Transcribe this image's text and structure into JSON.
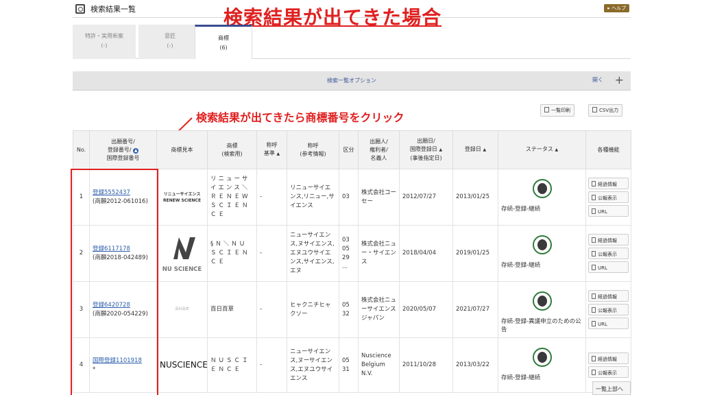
{
  "title_bar": {
    "title": "検索結果一覧",
    "help": "▸ ヘルプ"
  },
  "annotation_title": "検索結果が出てきた場合",
  "tabs": [
    {
      "label": "特許・実用新案",
      "count": "(-)"
    },
    {
      "label": "意匠",
      "count": "(-)"
    },
    {
      "label": "商標",
      "count": "(6)"
    }
  ],
  "options_bar": {
    "label": "検索一覧オプション",
    "open": "開く",
    "plus": "+"
  },
  "annotation_click": "検索結果が出てきたら商標番号をクリック",
  "buttons": {
    "print": "一覧印刷",
    "csv": "CSV出力"
  },
  "columns": {
    "no": "No.",
    "number": [
      "出願番号/",
      "登録番号/",
      "国際登録番号"
    ],
    "sample": "商標見本",
    "mark": [
      "商標",
      "(検索用)"
    ],
    "frame": [
      "称呼",
      "基準"
    ],
    "reading": [
      "称呼",
      "(参考情報)"
    ],
    "class": "区分",
    "applicant": [
      "出願人/",
      "権利者/",
      "名義人"
    ],
    "appdate": [
      "出願日/",
      "国際登録日",
      "(事後指定日)"
    ],
    "regdate": "登録日",
    "status": "ステータス",
    "funcs": "各種機能"
  },
  "func_labels": {
    "progress": "経過情報",
    "gazette": "公報表示",
    "url": "URL"
  },
  "rows": [
    {
      "no": "1",
      "link": "登録5552437",
      "sub": "(商願2012-061016)",
      "logo_line1": "リニューサイエンス",
      "logo_line2": "RENEW SCIENCE",
      "mark": "リニューサイエンス＼ＲＥＮＥＷ　ＳＣＩＥＮＣＥ",
      "frame": "-",
      "reading": "リニューサイエンス,リニュー,サイエンス",
      "class": "03",
      "applicant": "株式会社コーセー",
      "appdate": "2012/07/27",
      "regdate": "2013/01/25",
      "status": "存続-登録-継続"
    },
    {
      "no": "2",
      "link": "登録6117178",
      "sub": "(商願2018-042489)",
      "logo_text": "NU SCIENCE",
      "mark": "§Ｎ＼ＮＵ　ＳＣＩＥＮＣＥ",
      "frame": "-",
      "reading": "ニューサイエンス,ヌサイエンス,エヌユウサイエンス,サイエンス,エヌ",
      "class": "03\n05\n29\n...",
      "applicant": "株式会社ニュー・サイエンス",
      "appdate": "2018/04/04",
      "regdate": "2019/01/25",
      "status": "存続-登録-継続"
    },
    {
      "no": "3",
      "link": "登録6420728",
      "sub": "(商願2020-054229)",
      "logo_text": "百日百草",
      "mark": "百日百草",
      "frame": "-",
      "reading": "ヒャクニチヒャクソー",
      "class": "05\n32",
      "applicant": "株式会社ニューサイエンスジャパン",
      "appdate": "2020/05/07",
      "regdate": "2021/07/27",
      "status": "存続-登録-異議申立のための公告"
    },
    {
      "no": "4",
      "link": "国際登録1101918",
      "sub": "*",
      "logo_text": "NUSCIENCE",
      "mark": "ＮＵＳＣＩＥＮＣＥ",
      "frame": "-",
      "reading": "ニューサイエンス,ヌーサイエンス,エヌユウサイエンス",
      "class": "05\n31",
      "applicant": "Nuscience Belgium N.V.",
      "appdate": "2011/10/28",
      "regdate": "2013/03/22",
      "status": "存続-登録-継続"
    }
  ],
  "scroll_up": "一覧上部へ",
  "colors": {
    "accent_red": "#e02020",
    "link_blue": "#2a5caa",
    "tab_active": "#3a4b8f",
    "medal_green": "#2f7a3a"
  }
}
